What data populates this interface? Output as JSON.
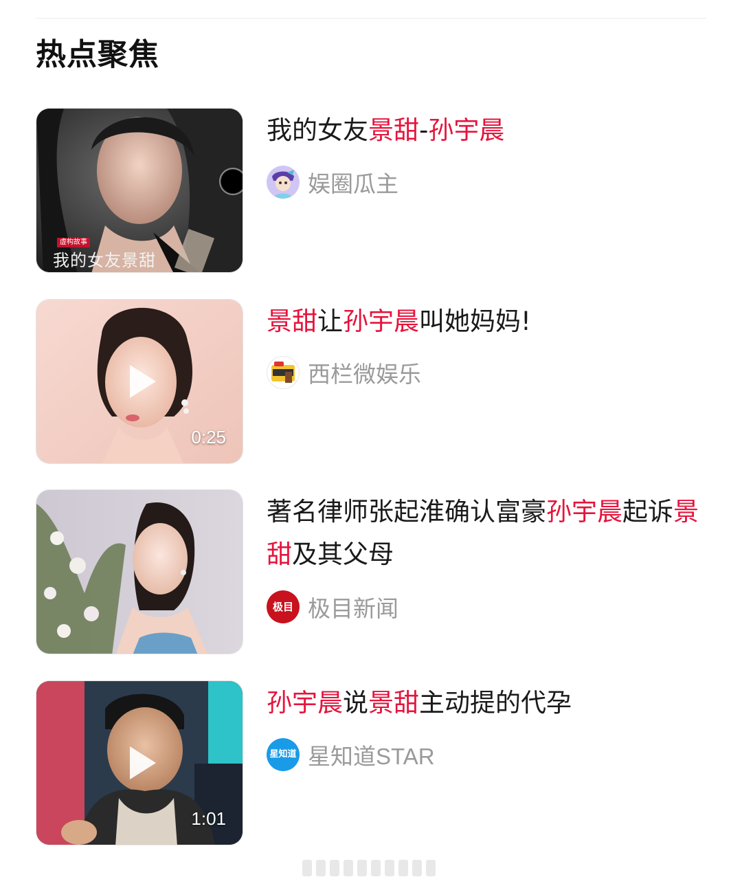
{
  "section": {
    "title": "热点聚焦"
  },
  "colors": {
    "highlight": "#e5143c",
    "source_text": "#9a9a9a",
    "title_text": "#1a1a1a"
  },
  "items": [
    {
      "title_parts": [
        {
          "text": "我的女友",
          "hl": false
        },
        {
          "text": "景甜",
          "hl": true
        },
        {
          "text": "-",
          "hl": false
        },
        {
          "text": "孙宇晨",
          "hl": true
        }
      ],
      "source": "娱圈瓜主",
      "is_video": false,
      "thumb_caption_small": "虚构故事",
      "thumb_caption": "我的女友景甜"
    },
    {
      "title_parts": [
        {
          "text": "景甜",
          "hl": true
        },
        {
          "text": "让",
          "hl": false
        },
        {
          "text": "孙宇晨",
          "hl": true
        },
        {
          "text": "叫她妈妈!",
          "hl": false
        }
      ],
      "source": "西栏微娱乐",
      "is_video": true,
      "duration": "0:25"
    },
    {
      "title_parts": [
        {
          "text": "著名律师张起淮确认富豪",
          "hl": false
        },
        {
          "text": "孙宇晨",
          "hl": true
        },
        {
          "text": "起诉",
          "hl": false
        },
        {
          "text": "景甜",
          "hl": true
        },
        {
          "text": "及其父母",
          "hl": false
        }
      ],
      "source": "极目新闻",
      "source_logo_text": "极目",
      "is_video": false
    },
    {
      "title_parts": [
        {
          "text": "孙宇晨",
          "hl": true
        },
        {
          "text": "说",
          "hl": false
        },
        {
          "text": "景甜",
          "hl": true
        },
        {
          "text": "主动提的代孕",
          "hl": false
        }
      ],
      "source": "星知道STAR",
      "source_logo_text": "星知道",
      "is_video": true,
      "duration": "1:01"
    }
  ]
}
